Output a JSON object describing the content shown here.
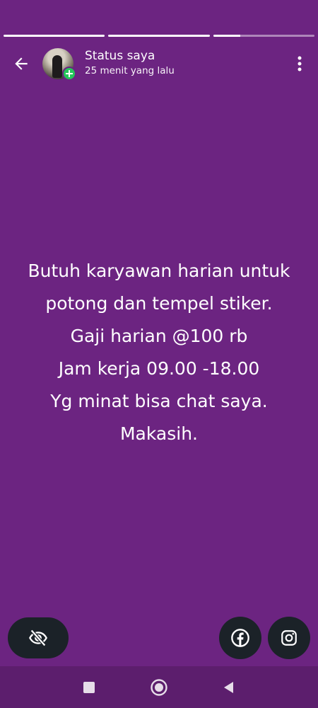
{
  "progress": {
    "segments": [
      1.0,
      1.0,
      0.27
    ]
  },
  "header": {
    "title": "Status saya",
    "subtitle": "25 menit yang lalu"
  },
  "status": {
    "lines": [
      "Butuh karyawan harian untuk",
      "potong dan tempel stiker.",
      "Gaji harian @100 rb",
      "Jam kerja 09.00 -18.00",
      "Yg minat bisa chat saya.",
      "Makasih."
    ],
    "background_color": "#6c2481"
  },
  "icons": {
    "back": "arrow-left-icon",
    "menu": "more-vert-icon",
    "avatar_badge": "plus-icon",
    "privacy": "eye-off-icon",
    "facebook": "facebook-icon",
    "instagram": "instagram-icon",
    "recents": "square-icon",
    "home": "circle-icon",
    "nav_back": "triangle-back-icon"
  },
  "colors": {
    "accent_green": "#25c65a",
    "button_dark": "#1b2228",
    "navbar": "#5c1e6d"
  }
}
